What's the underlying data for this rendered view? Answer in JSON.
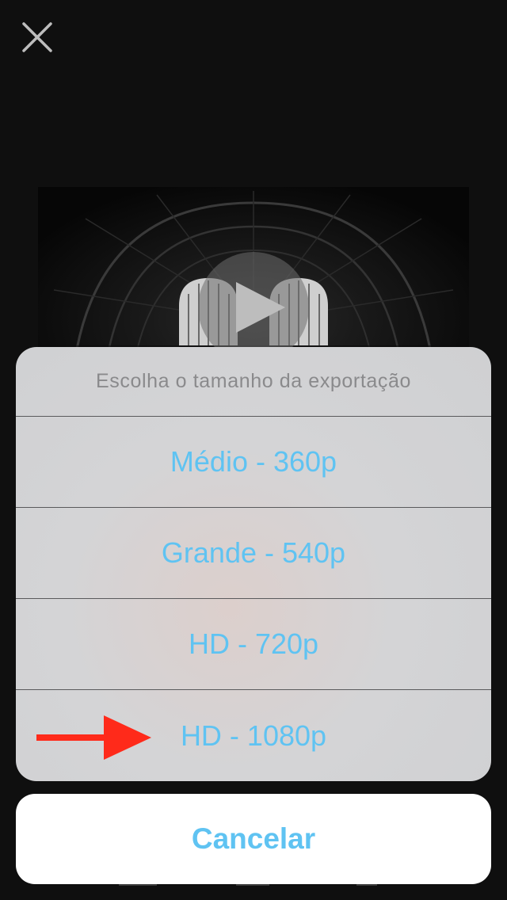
{
  "header": {
    "close_icon": "close-icon"
  },
  "video": {
    "play_icon": "play-icon"
  },
  "action_sheet": {
    "title": "Escolha o tamanho da exportação",
    "options": [
      {
        "label": "Médio - 360p"
      },
      {
        "label": "Grande - 540p"
      },
      {
        "label": "HD - 720p"
      },
      {
        "label": "HD - 1080p",
        "annotation": "red-arrow"
      }
    ],
    "cancel_label": "Cancelar"
  },
  "colors": {
    "accent": "#5fc3f2",
    "annotation": "#ff2a1a",
    "background": "#0f0f0f"
  }
}
